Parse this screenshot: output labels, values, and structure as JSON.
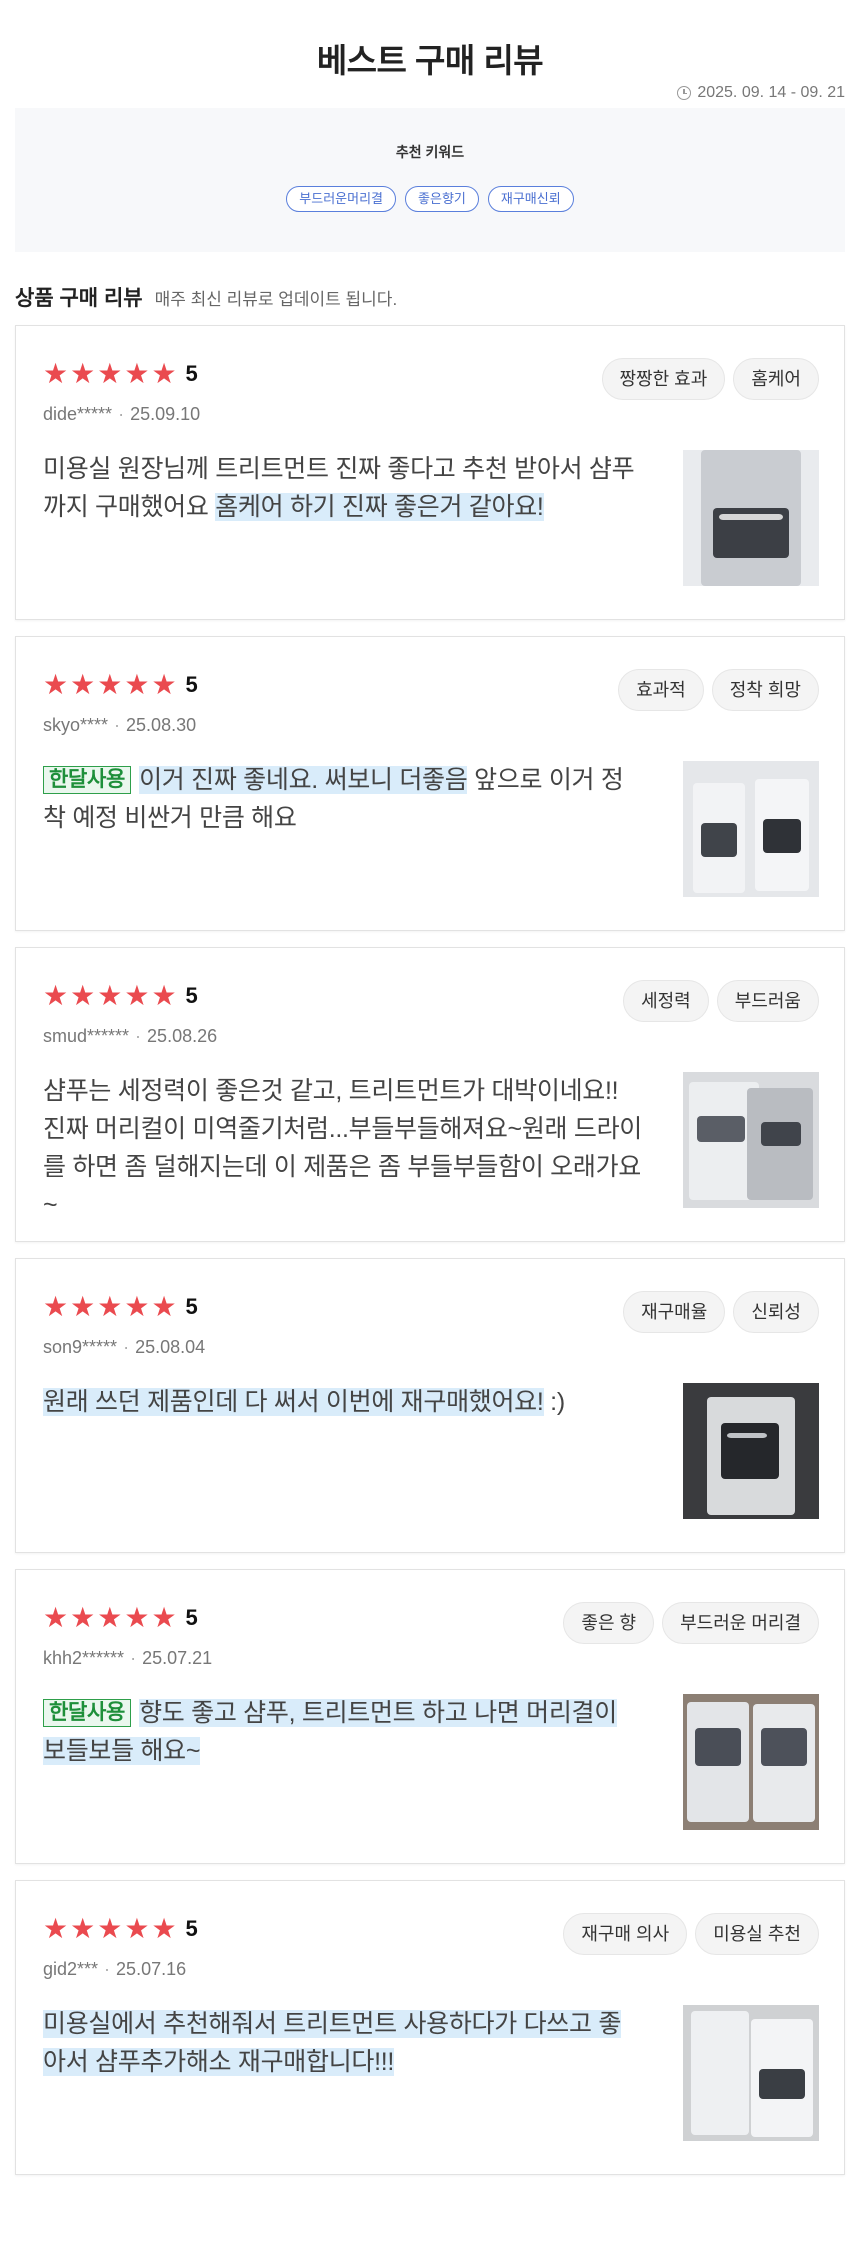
{
  "header": {
    "title": "베스트 구매 리뷰",
    "date_range": "2025. 09. 14 - 09. 21"
  },
  "keywords": {
    "title": "추천 키워드",
    "chips": [
      "부드러운머리결",
      "좋은향기",
      "재구매신뢰"
    ]
  },
  "section": {
    "title": "상품 구매 리뷰",
    "subtitle": "매주 최신 리뷰로 업데이트 됩니다."
  },
  "star_color": "#ea4a4f",
  "reviews": [
    {
      "rating": "5",
      "user": "dide*****",
      "date": "25.09.10",
      "tags": [
        "짱짱한 효과",
        "홈케어"
      ],
      "badge": "",
      "text_plain": "미용실 원장님께 트리트먼트 진짜 좋다고 추천 받아서 샴푸까지 구매했어요 ",
      "text_highlight": "홈케어 하기 진짜 좋은거 같아요!",
      "text_tail": ""
    },
    {
      "rating": "5",
      "user": "skyo****",
      "date": "25.08.30",
      "tags": [
        "효과적",
        "정착 희망"
      ],
      "badge": "한달사용",
      "text_plain": "",
      "text_highlight": "이거 진짜 좋네요. 써보니 더좋음",
      "text_tail": " 앞으로 이거 정착 예정 비싼거 만큼 해요"
    },
    {
      "rating": "5",
      "user": "smud******",
      "date": "25.08.26",
      "tags": [
        "세정력",
        "부드러움"
      ],
      "badge": "",
      "text_plain": "샴푸는 세정력이 좋은것 같고, 트리트먼트가 대박이네요!! 진짜 머리컬이 미역줄기처럼...부들부들해져요~원래 드라이를 하면 좀 덜해지는데 이 제품은 좀 부들부들함이 오래가요~",
      "text_highlight": "",
      "text_tail": ""
    },
    {
      "rating": "5",
      "user": "son9*****",
      "date": "25.08.04",
      "tags": [
        "재구매율",
        "신뢰성"
      ],
      "badge": "",
      "text_plain": "",
      "text_highlight": "원래 쓰던 제품인데 다 써서 이번에 재구매했어요!",
      "text_tail": " :)"
    },
    {
      "rating": "5",
      "user": "khh2******",
      "date": "25.07.21",
      "tags": [
        "좋은 향",
        "부드러운 머리결"
      ],
      "badge": "한달사용",
      "text_plain": "",
      "text_highlight": "향도 좋고 샴푸, 트리트먼트 하고 나면 머리결이 보들보들 해요~",
      "text_tail": ""
    },
    {
      "rating": "5",
      "user": "gid2***",
      "date": "25.07.16",
      "tags": [
        "재구매 의사",
        "미용실 추천"
      ],
      "badge": "",
      "text_plain": "",
      "text_highlight": "미용실에서 추천해줘서 트리트먼트 사용하다가 다쓰고 좋아서 샴푸추가해소 재구매합니다!!!",
      "text_tail": ""
    }
  ]
}
